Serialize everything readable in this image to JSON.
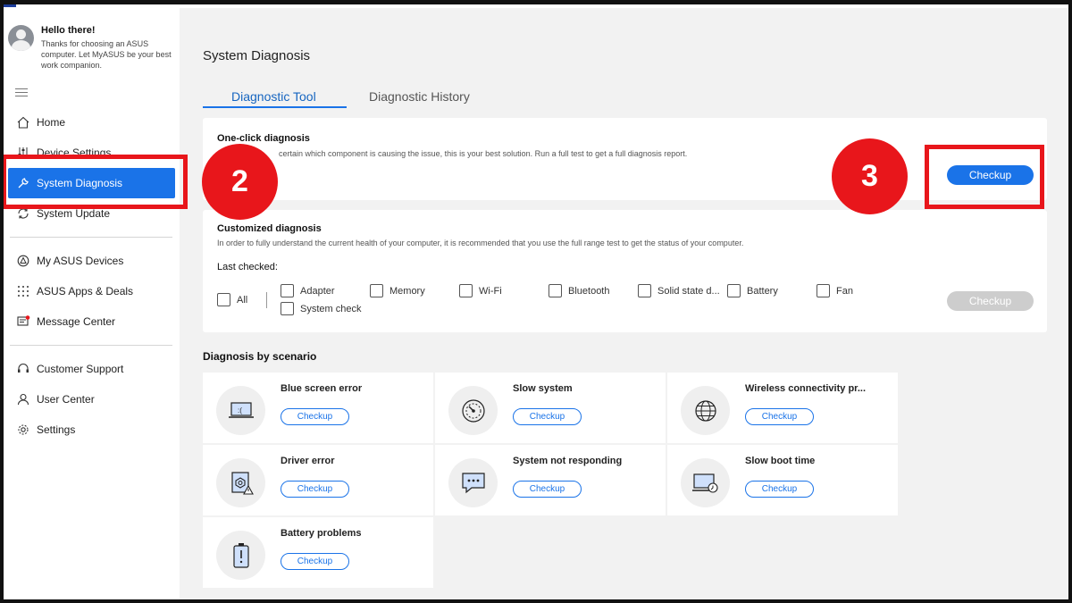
{
  "profile": {
    "greeting": "Hello there!",
    "message": "Thanks for choosing an ASUS computer. Let MyASUS be your best work companion."
  },
  "sidebar": {
    "items": [
      {
        "label": "Home",
        "icon": "home-icon"
      },
      {
        "label": "Device Settings",
        "icon": "settings-sliders-icon"
      },
      {
        "label": "System Diagnosis",
        "icon": "wrench-icon",
        "active": true
      },
      {
        "label": "System Update",
        "icon": "update-icon"
      },
      {
        "label": "My ASUS Devices",
        "icon": "devices-icon"
      },
      {
        "label": "ASUS Apps & Deals",
        "icon": "apps-grid-icon"
      },
      {
        "label": "Message Center",
        "icon": "message-icon"
      },
      {
        "label": "Customer Support",
        "icon": "headset-icon"
      },
      {
        "label": "User Center",
        "icon": "user-icon"
      },
      {
        "label": "Settings",
        "icon": "gear-icon"
      }
    ]
  },
  "main": {
    "title": "System Diagnosis",
    "tabs": [
      {
        "label": "Diagnostic Tool",
        "active": true
      },
      {
        "label": "Diagnostic History",
        "active": false
      }
    ],
    "one_click": {
      "title": "One-click diagnosis",
      "desc": "certain which component is causing the issue, this is your best solution. Run a full test to get a full diagnosis report.",
      "button": "Checkup"
    },
    "customized": {
      "title": "Customized diagnosis",
      "desc": "In order to fully understand the current health of your computer, it is recommended that you use the full range test to get the status of your computer.",
      "last_checked": "Last checked:",
      "options": [
        "All",
        "Adapter",
        "Memory",
        "Wi-Fi",
        "Bluetooth",
        "Solid state d...",
        "Battery",
        "Fan",
        "System check"
      ],
      "button": "Checkup"
    },
    "scenario_title": "Diagnosis by scenario",
    "scenarios": [
      {
        "title": "Blue screen error",
        "icon": "laptop-sad-icon",
        "button": "Checkup"
      },
      {
        "title": "Slow system",
        "icon": "speedometer-icon",
        "button": "Checkup"
      },
      {
        "title": "Wireless connectivity pr...",
        "icon": "globe-icon",
        "button": "Checkup"
      },
      {
        "title": "Driver error",
        "icon": "driver-warning-icon",
        "button": "Checkup"
      },
      {
        "title": "System not responding",
        "icon": "chat-dots-icon",
        "button": "Checkup"
      },
      {
        "title": "Slow boot time",
        "icon": "laptop-clock-icon",
        "button": "Checkup"
      },
      {
        "title": "Battery problems",
        "icon": "battery-alert-icon",
        "button": "Checkup"
      }
    ]
  },
  "annotations": {
    "step2": "2",
    "step3": "3",
    "color": "#e8161b"
  },
  "colors": {
    "accent": "#1a73e8",
    "main_bg": "#f2f2f2"
  }
}
